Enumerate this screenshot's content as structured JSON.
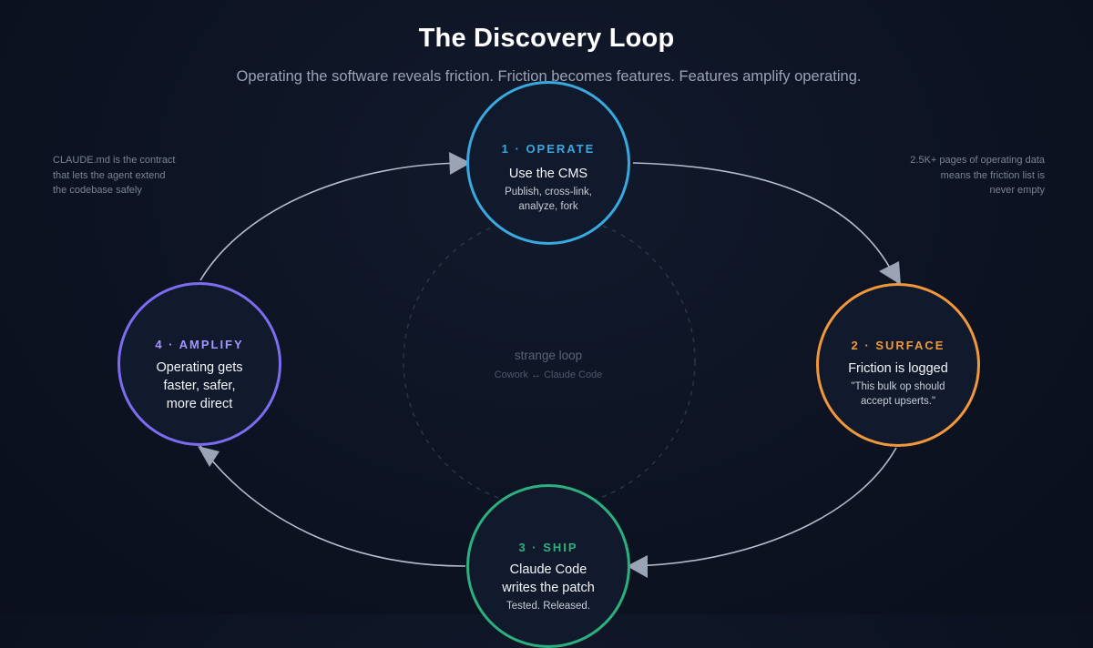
{
  "header": {
    "title": "The Discovery Loop",
    "subtitle": "Operating the software reveals friction. Friction becomes features. Features amplify operating."
  },
  "notes": {
    "left": [
      "CLAUDE.md is the contract",
      "that lets the agent extend",
      "the codebase safely"
    ],
    "right": [
      "2.5K+ pages of operating data",
      "means the friction list is",
      "never empty"
    ]
  },
  "center": {
    "label": "strange loop",
    "sublabel": "Cowork ↔ Claude Code"
  },
  "nodes": {
    "operate": {
      "step": "1 · OPERATE",
      "headline": [
        "Use the CMS"
      ],
      "detail": [
        "Publish, cross-link,",
        "analyze, fork"
      ],
      "color": "#39a9e0"
    },
    "surface": {
      "step": "2 · SURFACE",
      "headline": [
        "Friction is logged"
      ],
      "detail": [
        "\"This bulk op should",
        "accept upserts.\""
      ],
      "color": "#f0983a"
    },
    "ship": {
      "step": "3 · SHIP",
      "headline": [
        "Claude Code",
        "writes the patch"
      ],
      "detail": [
        "Tested. Released."
      ],
      "color": "#2cb07e"
    },
    "amplify": {
      "step": "4 · AMPLIFY",
      "headline": [
        "Operating gets",
        "faster, safer,",
        "more direct"
      ],
      "detail": [],
      "color": "#7c6cf0"
    }
  },
  "connectors": {
    "color": "#b4bccb"
  }
}
